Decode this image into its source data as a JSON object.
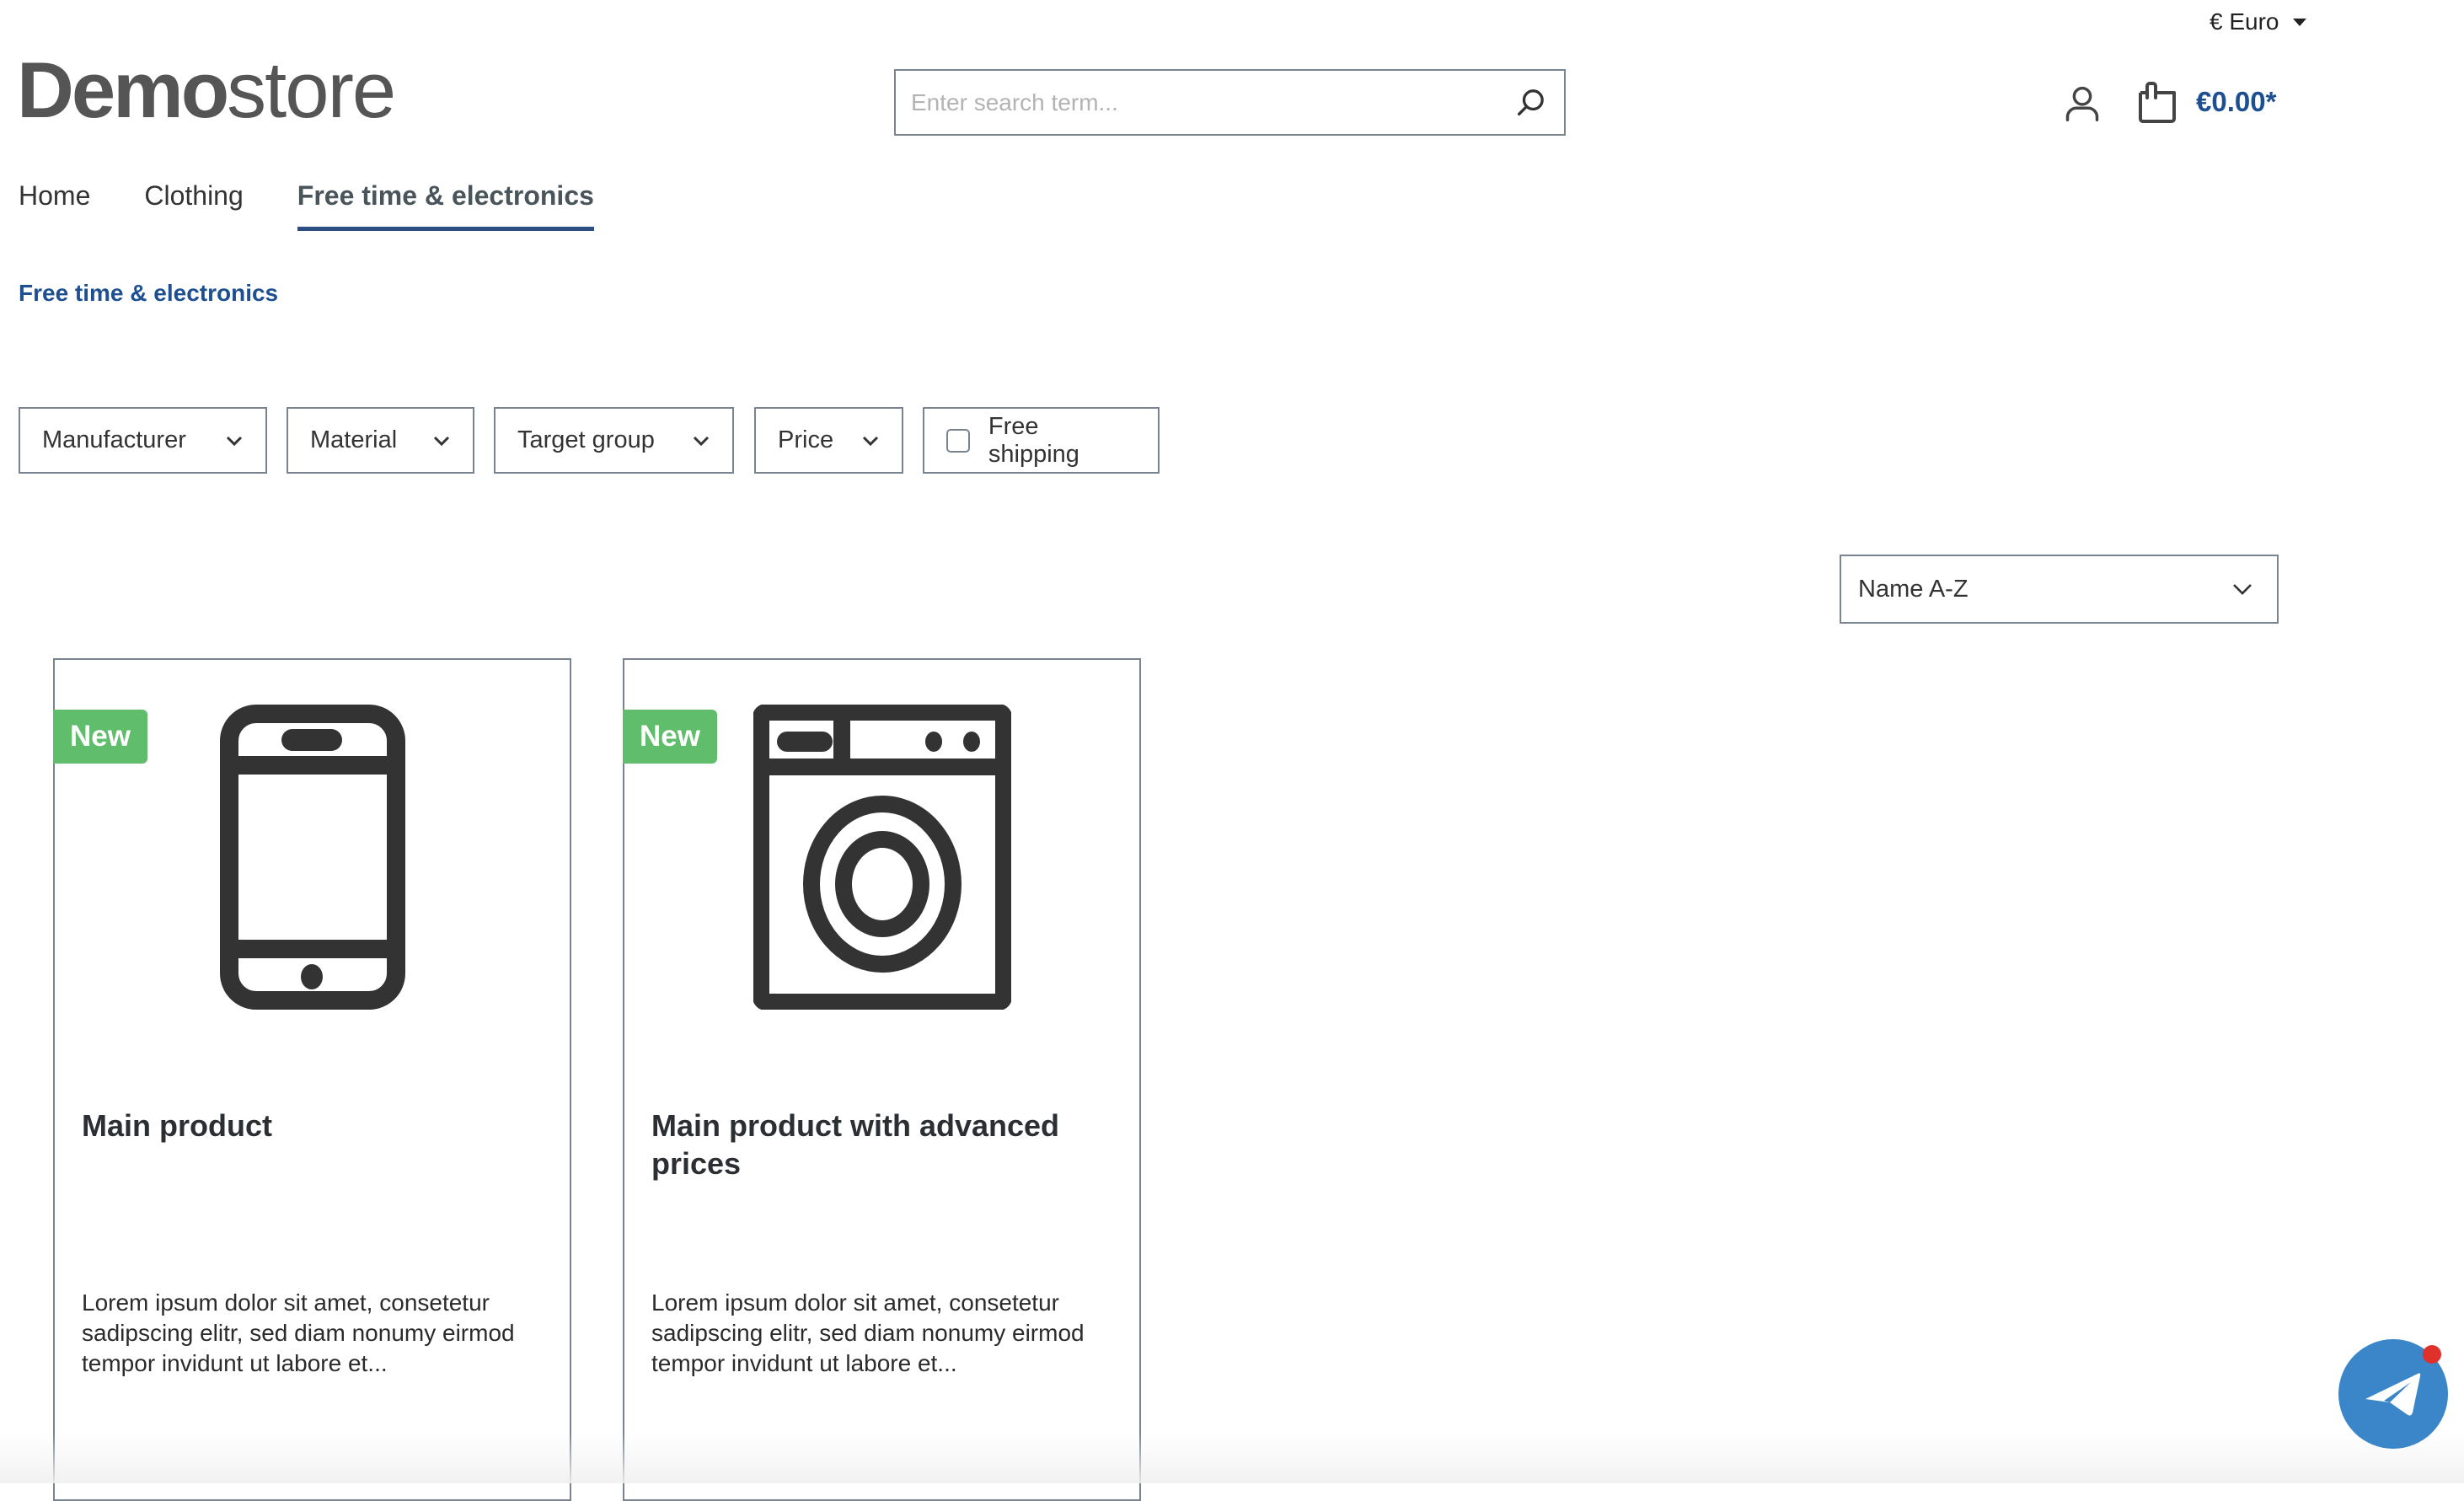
{
  "header": {
    "currency_label": "€ Euro",
    "logo": {
      "bold": "Demo",
      "light": "store"
    },
    "search": {
      "placeholder": "Enter search term...",
      "value": ""
    },
    "cart_total": "€0.00*"
  },
  "nav": {
    "items": [
      {
        "label": "Home",
        "active": false
      },
      {
        "label": "Clothing",
        "active": false
      },
      {
        "label": "Free time & electronics",
        "active": true
      }
    ]
  },
  "breadcrumb": {
    "current": "Free time & electronics"
  },
  "filters": {
    "items": [
      {
        "label": "Manufacturer",
        "type": "dropdown"
      },
      {
        "label": "Material",
        "type": "dropdown"
      },
      {
        "label": "Target group",
        "type": "dropdown"
      },
      {
        "label": "Price",
        "type": "dropdown"
      },
      {
        "label": "Free shipping",
        "type": "checkbox",
        "checked": false
      }
    ]
  },
  "sorting": {
    "selected": "Name A-Z"
  },
  "products": [
    {
      "badge": "New",
      "image_icon": "smartphone-icon",
      "title": "Main product",
      "description": "Lorem ipsum dolor sit amet, consetetur sadipscing elitr, sed diam nonumy eirmod tempor invidunt ut labore et..."
    },
    {
      "badge": "New",
      "image_icon": "washing-machine-icon",
      "title": "Main product with advanced prices",
      "description": "Lorem ipsum dolor sit amet, consetetur sadipscing elitr, sed diam nonumy eirmod tempor invidunt ut labore et..."
    }
  ],
  "colors": {
    "brand_blue": "#1d4f91",
    "nav_underline": "#2b4f83",
    "badge_new": "#5fbd6b",
    "chat_button": "#3a86c8",
    "notification_dot": "#e0302a",
    "border": "#798490"
  },
  "chat_widget": {
    "icon": "telegram-plane-icon",
    "has_notification": true
  }
}
